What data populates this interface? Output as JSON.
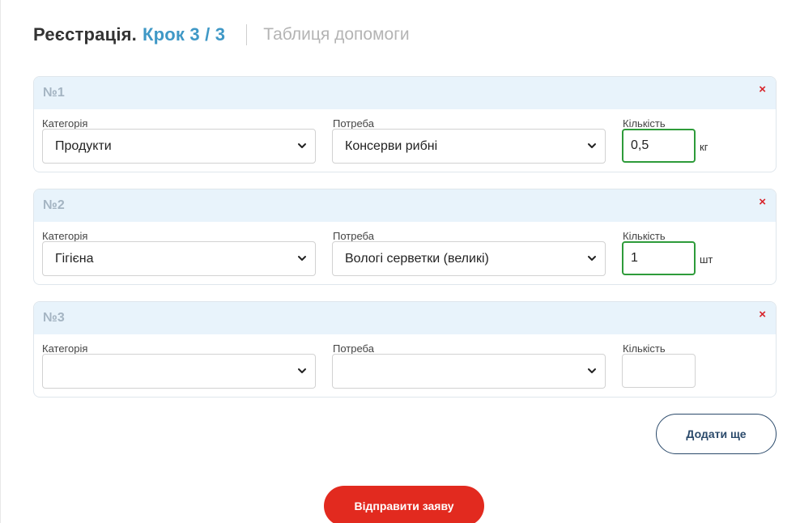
{
  "header": {
    "title": "Реєстрація.",
    "step": "Крок 3 / 3",
    "help_tab": "Таблиця допомоги"
  },
  "labels": {
    "category": "Категорія",
    "need": "Потреба",
    "quantity": "Кількість",
    "remove": "×"
  },
  "items": [
    {
      "num": "№1",
      "category": "Продукти",
      "need": "Консерви рибні",
      "quantity": "0,5",
      "unit": "кг",
      "valid": true
    },
    {
      "num": "№2",
      "category": "Гігієна",
      "need": "Вологі серветки (великі)",
      "quantity": "1",
      "unit": "шт",
      "valid": true
    },
    {
      "num": "№3",
      "category": "",
      "need": "",
      "quantity": "",
      "unit": "",
      "valid": false
    }
  ],
  "buttons": {
    "add_more": "Додати ще",
    "submit": "Відправити заяву"
  },
  "colors": {
    "accent_blue": "#3f98c6",
    "valid_green": "#2e9b3a",
    "remove_red": "#d8232a",
    "submit_red": "#e22a1f",
    "navy": "#2b4a6b",
    "card_header": "#e8f3fb"
  },
  "icons": {
    "remove": "close-icon",
    "select": "chevron-down-icon"
  }
}
